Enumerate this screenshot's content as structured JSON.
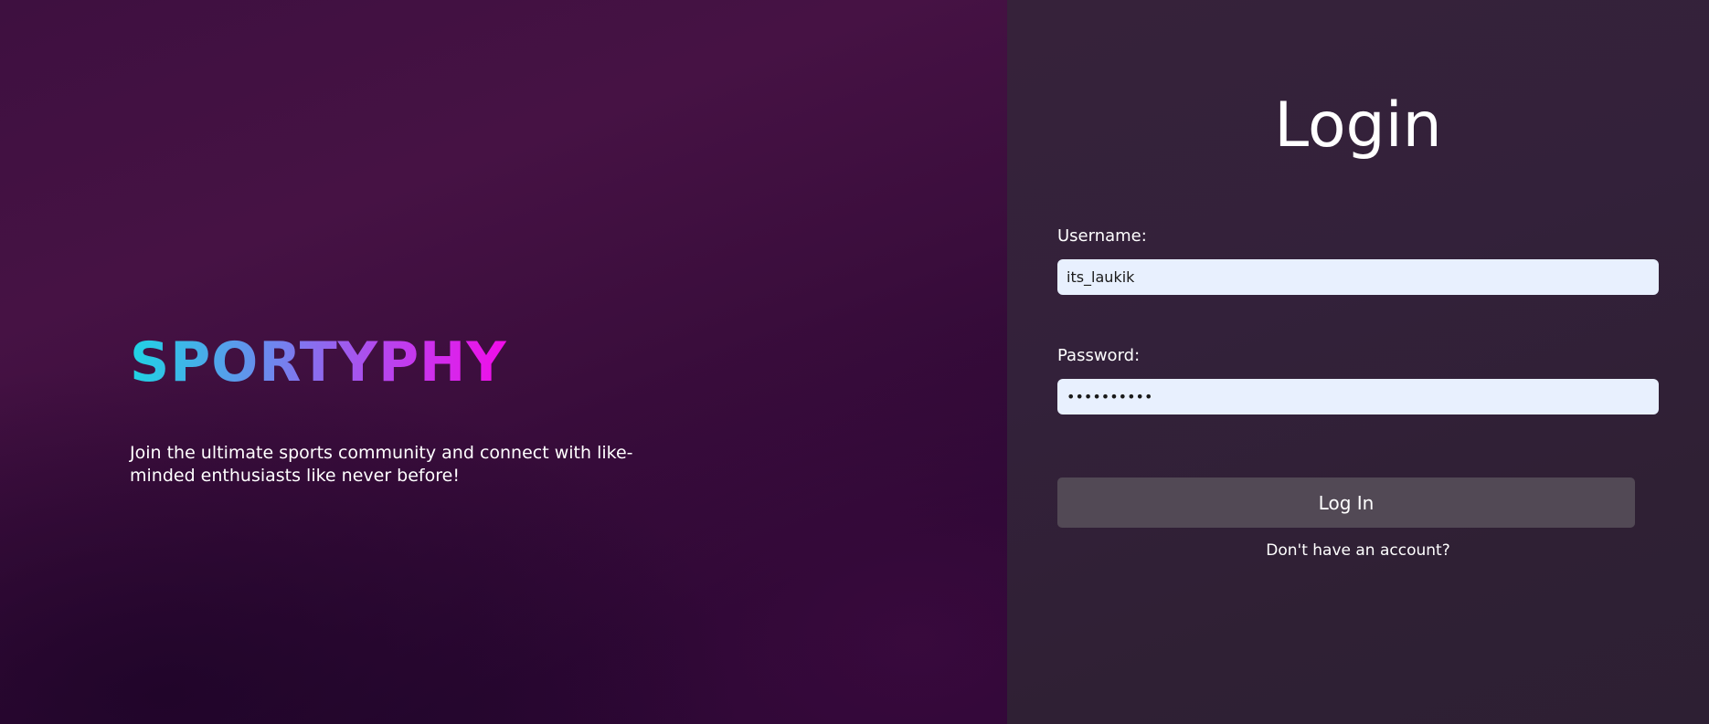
{
  "brand": {
    "name": "SPORTYPHY",
    "tagline": "Join the ultimate sports community and connect with like-minded enthusiasts like never before!",
    "gradient_colors": [
      "#1fd4e4",
      "#6f86ee",
      "#b448ee",
      "#f20ce9"
    ]
  },
  "login": {
    "title": "Login",
    "username_label": "Username:",
    "username_value": "its_laukik",
    "password_label": "Password:",
    "password_value": "laukik1234",
    "submit_label": "Log In",
    "signup_prompt": "Don't have an account?"
  },
  "colors": {
    "left_background": "#3e1040",
    "right_background": "#33213a",
    "input_background": "#e8f0fe",
    "button_background": "#524955",
    "text": "#ffffff"
  }
}
